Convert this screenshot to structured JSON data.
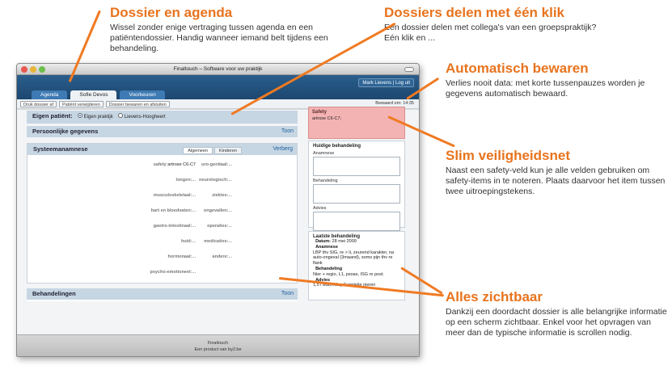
{
  "callouts": {
    "dossier": {
      "title": "Dossier en agenda",
      "text": "Wissel zonder enige vertraging tussen agenda en een patiëntendossier. Handig wanneer iemand belt tijdens een behandeling."
    },
    "share": {
      "title": "Dossiers delen met één klik",
      "text": "Een dossier delen met collega's van een groepspraktijk? Eén klik en ..."
    },
    "autosave": {
      "title": "Automatisch bewaren",
      "text": "Verlies nooit data: met korte tussenpauzes worden je gegevens automatisch bewaard."
    },
    "safety": {
      "title": "Slim veiligheidsnet",
      "text": "Naast een safety-veld kun je alle velden gebruiken om safety-items in te noteren. Plaats daarvoor het item tussen twee uitroepingstekens."
    },
    "visible": {
      "title": "Alles zichtbaar",
      "text": "Dankzij een doordacht dossier is alle belangrijke informatie op een scherm zichtbaar. Enkel voor het opvragen van meer dan de typische informatie is scrollen nodig."
    }
  },
  "window": {
    "title": "Finaltouch – Software voor uw praktijk",
    "user_button": "Mark Lievens | Log uit",
    "tabs": [
      "Agenda",
      "Sofie Devos",
      "Voorkeuren"
    ],
    "toolbar": [
      "Druk dossier af",
      "Patiënt verwijderen",
      "Dossier bewaren en afsluiten"
    ],
    "saved": "Bewaard om: 14:35"
  },
  "own_patient": {
    "label": "Eigen patiënt:",
    "options": [
      "Eigen praktijk",
      "Lievens-Hoogheert"
    ]
  },
  "personal": {
    "title": "Persoonlijke gegevens",
    "action": "Toon"
  },
  "system": {
    "title": "Systeemanamnese",
    "action": "Verberg",
    "subtabs": [
      "Algemeen",
      "Kinderen"
    ],
    "left_fields": [
      {
        "label": "safety:",
        "value": "artrose C6-C7"
      },
      {
        "label": "longen:",
        "value": "..."
      },
      {
        "label": "musculoskeletaal:",
        "value": "..."
      },
      {
        "label": "hart en bloedvaten:",
        "value": "..."
      },
      {
        "label": "gastro-intestinaal:",
        "value": "..."
      },
      {
        "label": "huid:",
        "value": "..."
      },
      {
        "label": "hormonaal:",
        "value": "..."
      },
      {
        "label": "psycho-emotioneel:",
        "value": "..."
      }
    ],
    "right_fields": [
      {
        "label": "uro-genitaal:",
        "value": "..."
      },
      {
        "label": "neurologisch:",
        "value": "..."
      },
      {
        "label": "ziektes:",
        "value": "..."
      },
      {
        "label": "ongevallen:",
        "value": "..."
      },
      {
        "label": "operaties:",
        "value": "..."
      },
      {
        "label": "medicaties:",
        "value": "..."
      },
      {
        "label": "andere:",
        "value": "..."
      }
    ]
  },
  "treatments": {
    "title": "Behandelingen",
    "action": "Toon"
  },
  "safety": {
    "title": "Safety",
    "value": "artrose C6-C7;"
  },
  "current": {
    "title": "Huidige behandeling",
    "labels": [
      "Anamnese",
      "Behandeling",
      "Advies"
    ]
  },
  "last": {
    "title": "Laatste behandeling",
    "date_label": "Datum:",
    "date": "28 mei 2009",
    "anamnese_label": "Anamnese",
    "anamnese": "LBP thv SIG, re > li, zeurend karakter, na auto-ongeval (3maand), soms pijn thv re flank",
    "behandeling_label": "Behandeling",
    "behandeling": "Nier + regio, L1, psoas, ISG re post.",
    "advies_label": "Advies",
    "advies": "1,5 l water/dag Suppletie nieren"
  },
  "footer": {
    "line1": "Finaltouch",
    "line2": "Een product van by2.be"
  },
  "colors": {
    "accent": "#e8731d",
    "header": "#1c4770",
    "safety": "#f4b3b3"
  }
}
